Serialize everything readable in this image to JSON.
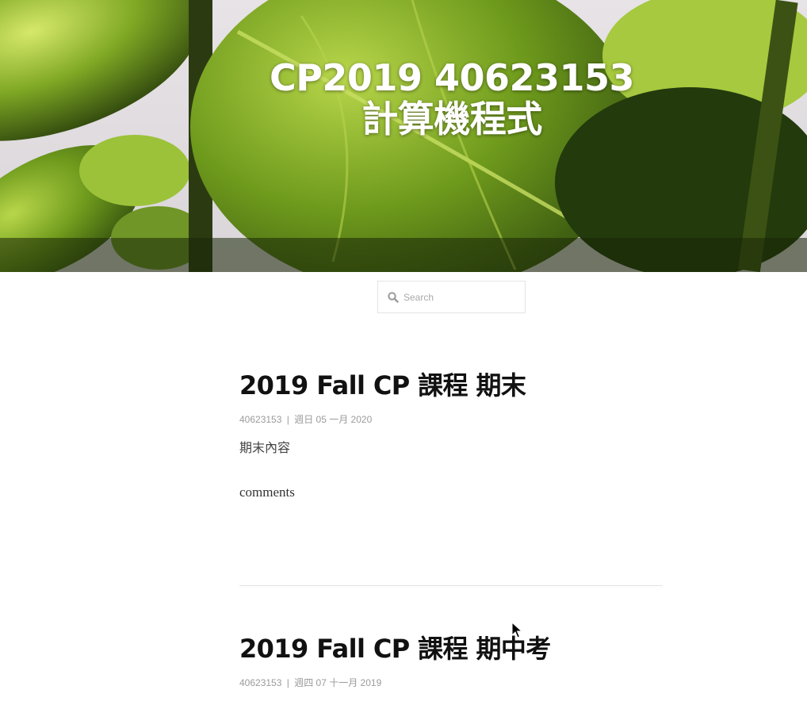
{
  "site": {
    "title": "CP2019 40623153 計算機程式"
  },
  "search": {
    "placeholder": "Search"
  },
  "posts": [
    {
      "title": "2019 Fall CP 課程 期末",
      "author": "40623153",
      "separator": "|",
      "date": "週日 05 一月 2020",
      "body": "期末內容",
      "comments_label": "comments"
    },
    {
      "title": "2019 Fall CP 課程 期中考",
      "author": "40623153",
      "separator": "|",
      "date": "週四 07 十一月 2019"
    }
  ],
  "icons": {
    "search": "search-icon",
    "cursor": "mouse-cursor-icon"
  },
  "colors": {
    "title_text": "#ffffff",
    "post_title": "#111111",
    "meta": "#9b9b9b",
    "divider": "#e3e3e3"
  }
}
